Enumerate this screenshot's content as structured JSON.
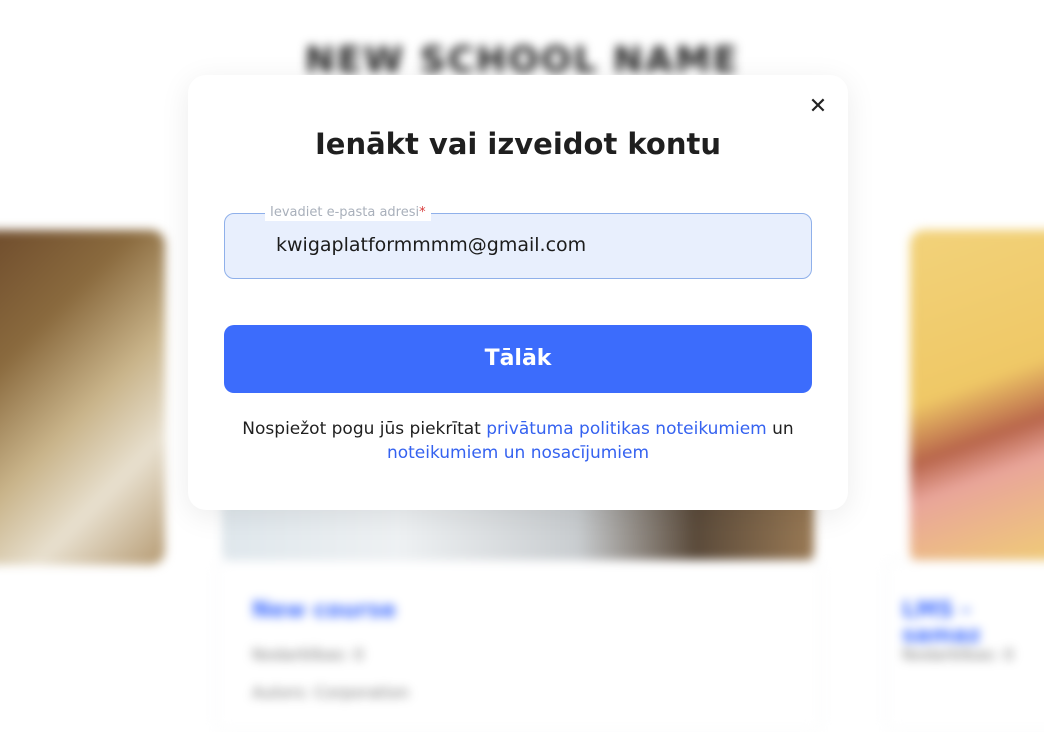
{
  "background": {
    "school_name": "NEW SCHOOL NAME",
    "course_title": "New course",
    "course_meta": "Nodarbības: 0",
    "course_author": "Autors: Corporation",
    "right_course_title": "LMS - samaz",
    "right_course_meta": "Nodarbības: 0"
  },
  "modal": {
    "title": "Ienākt vai izveidot kontu",
    "close_icon": "close-icon",
    "email_label": "Ievadiet e-pasta adresi",
    "email_required_mark": "*",
    "email_value": "kwigaplatformmmm@gmail.com",
    "submit_label": "Tālāk",
    "terms_prefix": "Nospiežot pogu jūs piekrītat ",
    "privacy_link": "privātuma politikas noteikumiem",
    "terms_join": " un",
    "terms_link": "noteikumiem un nosacījumiem"
  },
  "colors": {
    "accent": "#3c6cfc",
    "link": "#3562f0",
    "input_bg": "#e8effd"
  }
}
